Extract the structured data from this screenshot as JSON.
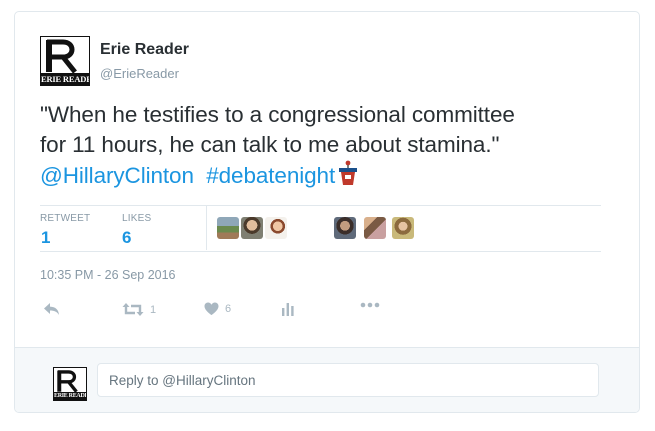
{
  "tweet": {
    "author": {
      "name": "Erie Reader",
      "handle": "@ErieReader",
      "logo_text": "ERIE READER"
    },
    "text_line1": "\"When he testifies to a congressional committee",
    "text_line2": "for 11 hours, he can talk to me about stamina.\"",
    "mention": "@HillaryClinton",
    "hashtag": "#debatenight",
    "hashtag_icon": "debate-podium-icon",
    "stats": {
      "retweet_label": "RETWEET",
      "retweet_count": "1",
      "likes_label": "LIKES",
      "likes_count": "6"
    },
    "likers": [
      "avatar-1",
      "avatar-2",
      "avatar-3",
      "avatar-4",
      "avatar-5",
      "avatar-6"
    ],
    "timestamp": "10:35 PM - 26 Sep 2016",
    "actions": {
      "reply_icon": "reply-icon",
      "retweet_icon": "retweet-icon",
      "retweet_count": "1",
      "like_icon": "heart-icon",
      "like_count": "6",
      "analytics_icon": "analytics-icon",
      "more_icon": "more-icon"
    }
  },
  "reply": {
    "placeholder": "Reply to @HillaryClinton"
  },
  "colors": {
    "link": "#1b95e0",
    "text": "#292f33",
    "muted": "#8899a6",
    "icon": "#aab8c2",
    "border": "#e1e8ed",
    "reply_bg": "#f5f8fa"
  }
}
